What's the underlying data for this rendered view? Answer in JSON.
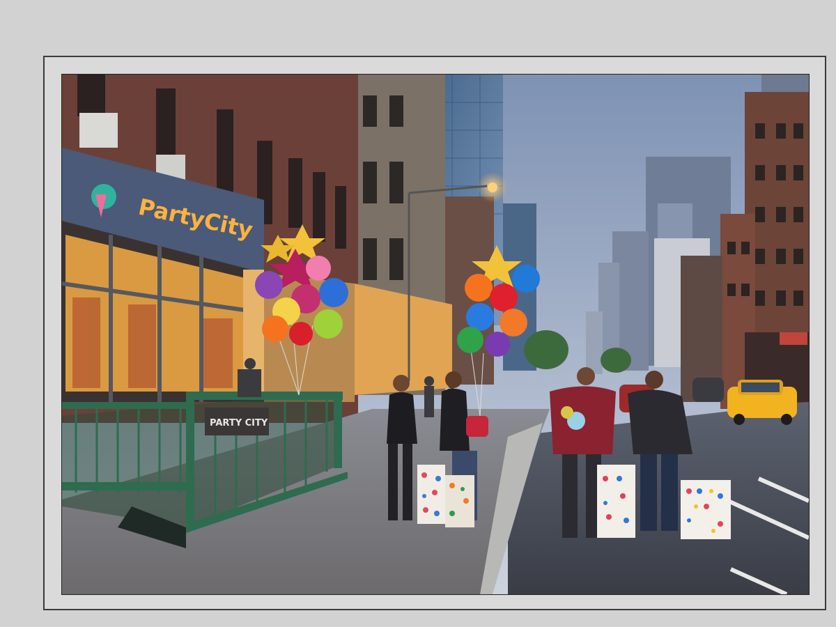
{
  "photo": {
    "store_sign": "PartyCity",
    "subway_sign": "PARTY CITY",
    "colors": {
      "sky_top": "#7f93b5",
      "sky_bottom": "#c8cfdc",
      "brick": "#6b4038",
      "sign_text": "#ffb23c",
      "railing": "#2f6b4f",
      "taxi": "#f2b321"
    }
  }
}
